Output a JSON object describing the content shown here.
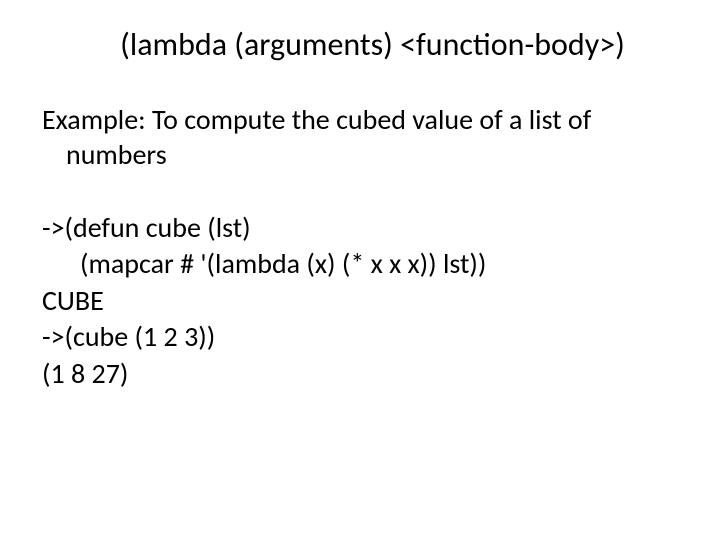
{
  "slide": {
    "title": "(lambda (arguments) <function-body>)",
    "example_intro_line1": "Example: To compute the cubed value of a list of",
    "example_intro_line2": "numbers",
    "code": {
      "line1": "->(defun cube (lst)",
      "line2": "(mapcar  # '(lambda (x) (* x x x)) lst))",
      "line3": "CUBE",
      "line4": "->(cube (1 2 3))",
      "line5": "(1 8 27)"
    }
  }
}
